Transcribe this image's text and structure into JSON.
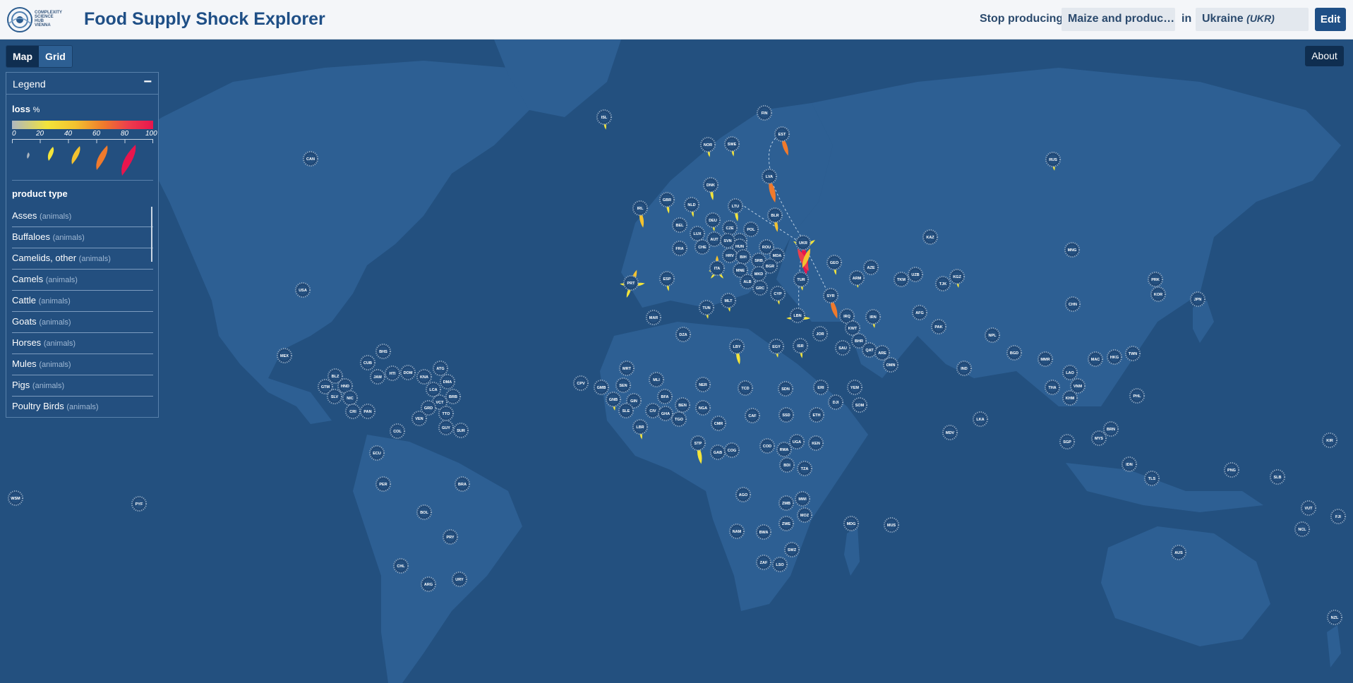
{
  "header": {
    "logo_lines": [
      "COMPLEXITY",
      "SCIENCE",
      "HUB",
      "VIENNA"
    ],
    "title": "Food Supply Shock Explorer",
    "stop_label": "Stop producing",
    "product_value": "Maize and produc…",
    "in_label": "in",
    "country_name": "Ukraine",
    "country_code": "(UKR)",
    "edit_label": "Edit"
  },
  "view": {
    "map_label": "Map",
    "grid_label": "Grid",
    "about_label": "About"
  },
  "legend": {
    "title": "Legend",
    "collapse_symbol": "−",
    "loss_label": "loss",
    "loss_unit": "%",
    "scale": [
      "0",
      "20",
      "40",
      "60",
      "80",
      "100"
    ],
    "product_type_label": "product type",
    "product_types": [
      {
        "name": "Asses",
        "category": "(animals)"
      },
      {
        "name": "Buffaloes",
        "category": "(animals)"
      },
      {
        "name": "Camelids, other",
        "category": "(animals)"
      },
      {
        "name": "Camels",
        "category": "(animals)"
      },
      {
        "name": "Cattle",
        "category": "(animals)"
      },
      {
        "name": "Goats",
        "category": "(animals)"
      },
      {
        "name": "Horses",
        "category": "(animals)"
      },
      {
        "name": "Mules",
        "category": "(animals)"
      },
      {
        "name": "Pigs",
        "category": "(animals)"
      },
      {
        "name": "Poultry Birds",
        "category": "(animals)"
      }
    ]
  },
  "colors": {
    "ocean": "#23507f",
    "land": "#2d5f93",
    "header_bg": "#f4f6f9",
    "brand_blue": "#1f4f86",
    "loss_low": "#aeb7c0",
    "loss_yellow": "#f3e43a",
    "loss_orange": "#f07a2c",
    "loss_red": "#e8154d"
  },
  "countries": [
    "ISL",
    "FIN",
    "EST",
    "NOR",
    "SWE",
    "LVA",
    "DNK",
    "LTU",
    "BLR",
    "RUS",
    "CAN",
    "IRL",
    "GBR",
    "NLD",
    "DEU",
    "POL",
    "BEL",
    "LUX",
    "CZE",
    "UKR",
    "FRA",
    "CHE",
    "AUT",
    "SVK",
    "HUN",
    "ROU",
    "SVN",
    "HRV",
    "BIH",
    "SRB",
    "MDA",
    "KAZ",
    "MNG",
    "ITA",
    "MNE",
    "BGR",
    "GEO",
    "PRT",
    "ESP",
    "ALB",
    "MKD",
    "GRC",
    "TUR",
    "ARM",
    "AZE",
    "TKM",
    "UZB",
    "KGZ",
    "TJK",
    "PRK",
    "KOR",
    "JPN",
    "USA",
    "MLT",
    "CYP",
    "SYR",
    "TUN",
    "MAR",
    "LBN",
    "IRQ",
    "IRN",
    "AFG",
    "CHN",
    "DZA",
    "ISR",
    "JOR",
    "KWT",
    "PAK",
    "LBY",
    "EGY",
    "SAU",
    "BHR",
    "QAT",
    "ARE",
    "OMN",
    "NPL",
    "BGD",
    "MMR",
    "TWN",
    "MEX",
    "BHS",
    "CUB",
    "IND",
    "LAO",
    "HKG",
    "MAC",
    "ERI",
    "YEM",
    "SDN",
    "TCD",
    "NER",
    "MLI",
    "MRT",
    "CPV",
    "SEN",
    "GMB",
    "GNB",
    "GIN",
    "BFA",
    "SLE",
    "LBR",
    "CIV",
    "GHA",
    "TGO",
    "BEN",
    "NGA",
    "DJI",
    "SOM",
    "ETH",
    "CAF",
    "SSD",
    "CMR",
    "THA",
    "VNM",
    "KHM",
    "PHL",
    "LKA",
    "MDV",
    "BRN",
    "MYS",
    "SGP",
    "IDN",
    "KIR",
    "BLZ",
    "GTM",
    "HND",
    "SLV",
    "NIC",
    "CRI",
    "PAN",
    "JAM",
    "HTI",
    "DOM",
    "KNA",
    "ATG",
    "DMA",
    "LCA",
    "VCT",
    "BRB",
    "GRD",
    "TTO",
    "VEN",
    "GUY",
    "SUR",
    "COL",
    "ECU",
    "GAB",
    "COG",
    "COD",
    "UGA",
    "KEN",
    "RWA",
    "BDI",
    "TZA",
    "STP",
    "AGO",
    "MWI",
    "ZMB",
    "MOZ",
    "ZWE",
    "MDG",
    "MUS",
    "NAM",
    "BWA",
    "SWZ",
    "ZAF",
    "LSO",
    "PER",
    "BRA",
    "BOL",
    "PRY",
    "CHL",
    "ARG",
    "URY",
    "WSM",
    "PYF",
    "PNG",
    "SLB",
    "TLS",
    "VUT",
    "NCL",
    "FJI",
    "AUS",
    "NZL"
  ]
}
